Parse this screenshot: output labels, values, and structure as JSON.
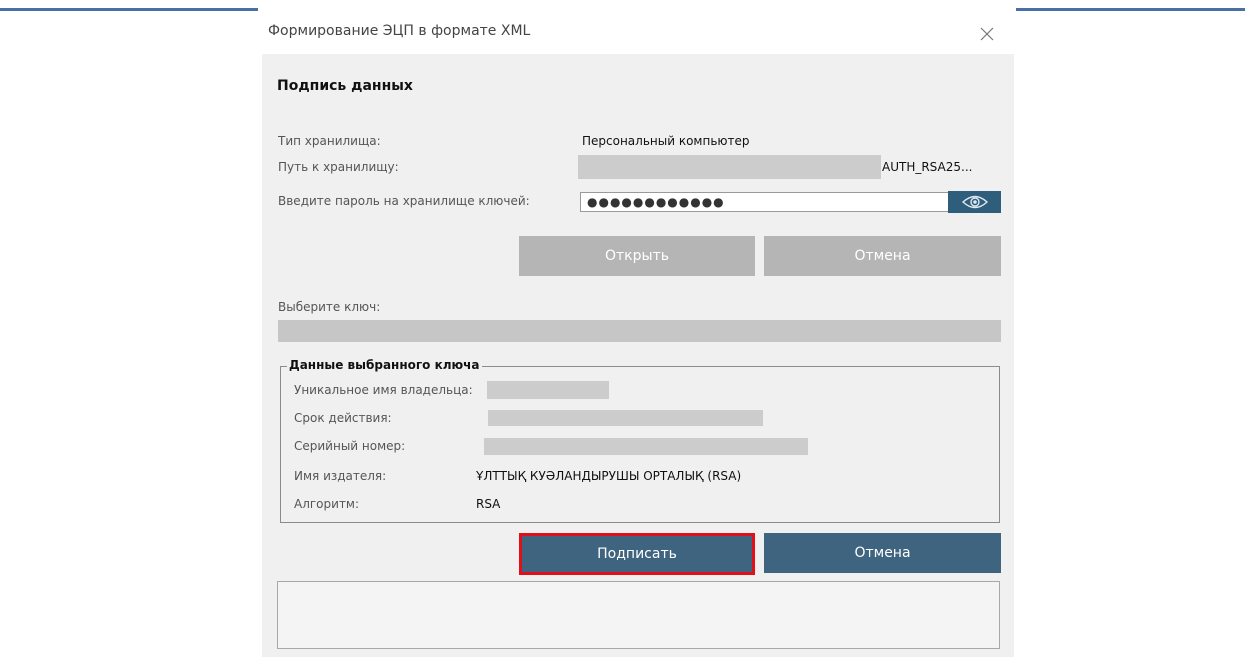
{
  "dialog": {
    "title": "Формирование ЭЦП в формате XML",
    "section_title": "Подпись данных"
  },
  "storage": {
    "type_label": "Тип хранилища:",
    "type_value": "Персональный компьютер",
    "path_label": "Путь к хранилищу:",
    "path_value": "AUTH_RSA25...",
    "password_label": "Введите пароль на хранилище ключей:",
    "password_value": "●●●●●●●●●●●●"
  },
  "buttons": {
    "open": "Открыть",
    "cancel_top": "Отмена",
    "sign": "Подписать",
    "cancel_bottom": "Отмена"
  },
  "key": {
    "select_label": "Выберите ключ:"
  },
  "key_details": {
    "group_title": "Данные выбранного ключа",
    "owner_label": "Уникальное имя владельца:",
    "validity_label": "Срок действия:",
    "serial_label": "Серийный номер:",
    "issuer_label": "Имя издателя:",
    "issuer_value": "ҰЛТТЫҚ КУӘЛАНДЫРУШЫ ОРТАЛЫҚ (RSA)",
    "algorithm_label": "Алгоритм:",
    "algorithm_value": "RSA"
  },
  "icons": {
    "close": "close-icon",
    "eye": "eye-icon"
  },
  "colors": {
    "primary_button": "#3f647f",
    "disabled_button": "#b5b5b5",
    "highlight": "#e0101a",
    "eye_button": "#2f5e7d"
  }
}
